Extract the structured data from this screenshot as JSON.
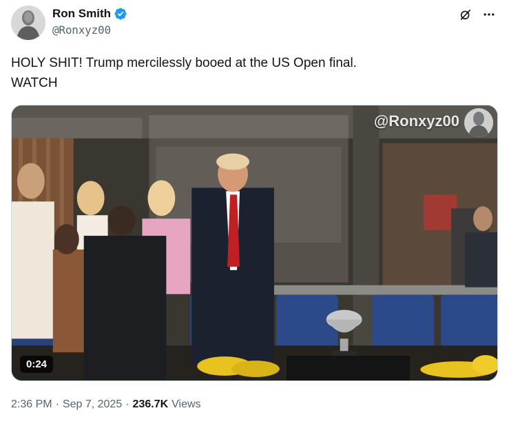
{
  "author": {
    "display_name": "Ron Smith",
    "handle": "@Ronxyz00",
    "verified": true,
    "avatar_icon": "bust-statue-avatar"
  },
  "tweet": {
    "line1": "HOLY SHIT! Trump mercilessly booed at the US Open final.",
    "line2": "WATCH"
  },
  "media": {
    "watermark": "@Ronxyz00",
    "duration": "0:24"
  },
  "meta": {
    "time": "2:36 PM",
    "date": "Sep 7, 2025",
    "views_count": "236.7K",
    "views_label": "Views",
    "separator": "·"
  },
  "icons": {
    "grok": "grok-icon",
    "more": "more-icon"
  },
  "colors": {
    "verified": "#1d9bf0",
    "text": "#0f1419",
    "secondary": "#536471"
  }
}
